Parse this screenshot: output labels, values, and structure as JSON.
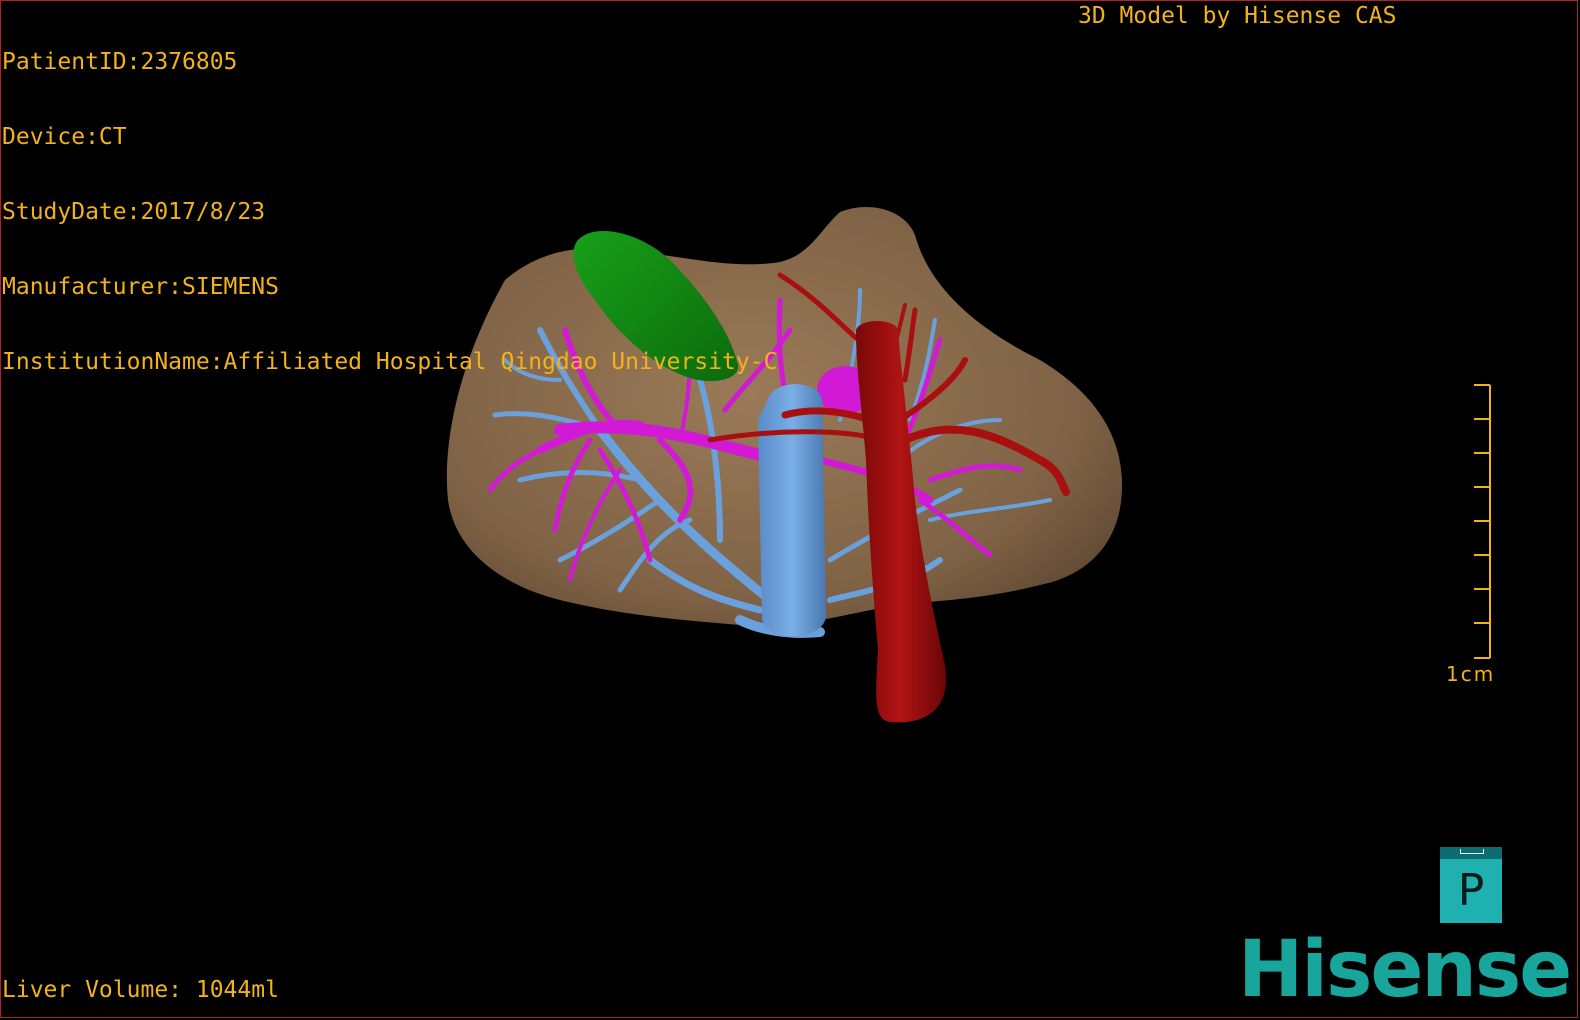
{
  "overlay": {
    "patient_id": "PatientID:2376805",
    "device": "Device:CT",
    "study_date": "StudyDate:2017/8/23",
    "manufacturer": "Manufacturer:SIEMENS",
    "institution": "InstitutionName:Affiliated Hospital Qingdao University-C",
    "credit": "3D Model by Hisense CAS",
    "liver_volume": "Liver Volume: 1044ml"
  },
  "scale": {
    "label": "1cm"
  },
  "view_button": {
    "label": "P"
  },
  "logo": {
    "text": "Hisense"
  },
  "colors": {
    "text": "#f2b21c",
    "liver": "#86684a",
    "gallbladder": "#1c9a1c",
    "portal_vein": "#6aa0dc",
    "hepatic_vein": "#d21ad6",
    "artery": "#a81010",
    "brand": "#17a59c"
  }
}
